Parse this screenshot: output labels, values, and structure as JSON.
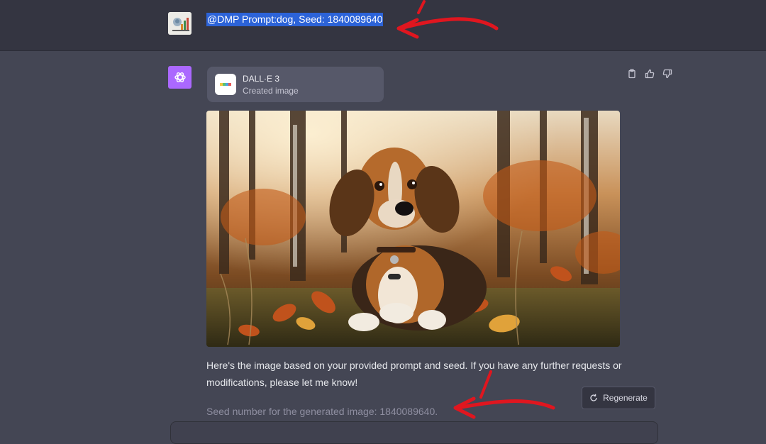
{
  "user_message": {
    "avatar_icon": "user-avatar-icon",
    "text": "@DMP Prompt:dog, Seed: 1840089640",
    "highlight_color": "#2c63d8"
  },
  "assistant_message": {
    "avatar_icon": "openai-logo-icon",
    "avatar_color": "#ab68ff",
    "tool": {
      "name": "DALL·E 3",
      "status": "Created image",
      "icon": "dalle-icon"
    },
    "actions": [
      "copy-icon",
      "thumbs-up-icon",
      "thumbs-down-icon"
    ],
    "image_icon": "generated-dog-image",
    "reply": "Here's the image based on your provided prompt and seed. If you have any further requests or modifications, please let me know!",
    "seed_note": "Seed number for the generated image: 1840089640."
  },
  "controls": {
    "regenerate_label": "Regenerate",
    "regenerate_icon": "refresh-icon"
  },
  "colors": {
    "page_bg": "#444654",
    "user_row_bg": "#343541",
    "annotation_arrow": "#e0161f"
  }
}
